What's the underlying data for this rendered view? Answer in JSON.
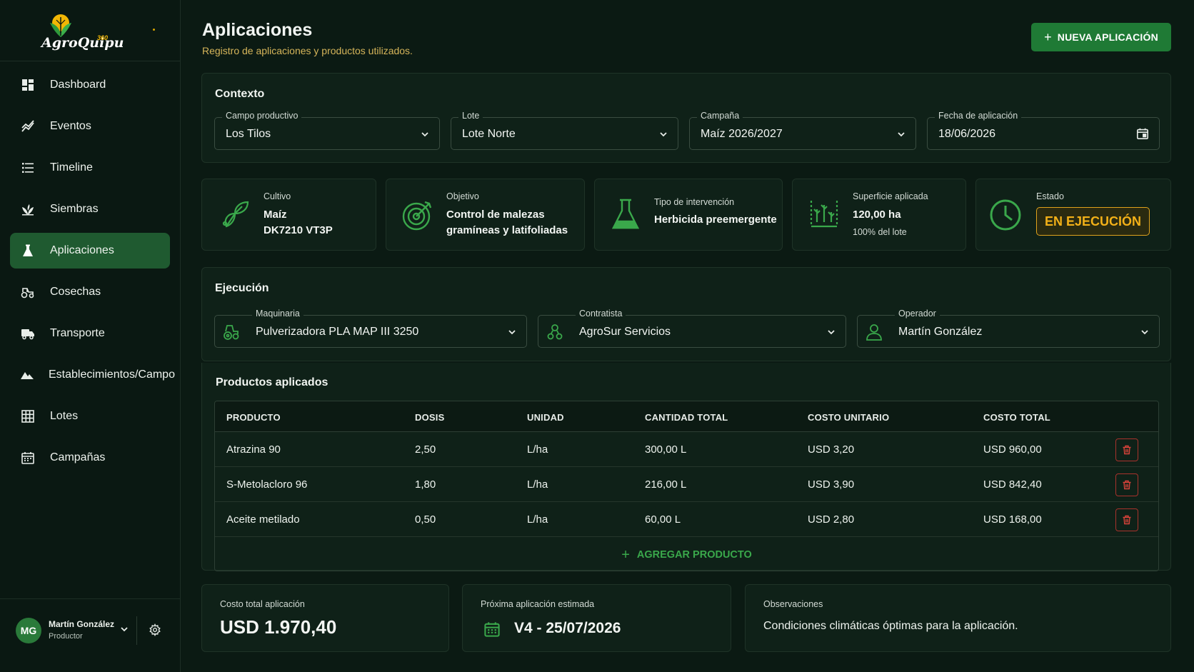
{
  "app": {
    "logo_text": "AgroQuipu",
    "logo_badge": "360"
  },
  "sidebar": {
    "items": [
      {
        "label": "Dashboard",
        "icon": "dashboard-icon"
      },
      {
        "label": "Eventos",
        "icon": "chart-line-icon"
      },
      {
        "label": "Timeline",
        "icon": "list-icon"
      },
      {
        "label": "Siembras",
        "icon": "sprout-icon"
      },
      {
        "label": "Aplicaciones",
        "icon": "flask-icon",
        "active": true
      },
      {
        "label": "Cosechas",
        "icon": "tractor-icon"
      },
      {
        "label": "Transporte",
        "icon": "truck-icon"
      },
      {
        "label": "Establecimientos/Campo",
        "icon": "mountain-icon"
      },
      {
        "label": "Lotes",
        "icon": "grid-icon"
      },
      {
        "label": "Campañas",
        "icon": "calendar-icon"
      }
    ]
  },
  "user": {
    "initials": "MG",
    "name": "Martín González",
    "role": "Productor"
  },
  "header": {
    "title": "Aplicaciones",
    "subtitle": "Registro de aplicaciones y productos utilizados.",
    "new_button": "NUEVA APLICACIÓN"
  },
  "context": {
    "title": "Contexto",
    "campo": {
      "label": "Campo productivo",
      "value": "Los Tilos"
    },
    "lote": {
      "label": "Lote",
      "value": "Lote Norte"
    },
    "campana": {
      "label": "Campaña",
      "value": "Maíz 2026/2027"
    },
    "fecha": {
      "label": "Fecha de aplicación",
      "value": "18/06/2026"
    }
  },
  "stats": {
    "cultivo": {
      "label": "Cultivo",
      "line1": "Maíz",
      "line2": "DK7210 VT3P"
    },
    "objetivo": {
      "label": "Objetivo",
      "line1": "Control de malezas",
      "line2": "gramíneas y latifoliadas"
    },
    "tipo": {
      "label": "Tipo de intervención",
      "value": "Herbicida preemergente"
    },
    "superficie": {
      "label": "Superficie aplicada",
      "value": "120,00 ha",
      "sub": "100% del lote"
    },
    "estado": {
      "label": "Estado",
      "value": "EN EJECUCIÓN"
    }
  },
  "execution": {
    "title": "Ejecución",
    "maquinaria": {
      "label": "Maquinaria",
      "value": "Pulverizadora PLA MAP III 3250"
    },
    "contratista": {
      "label": "Contratista",
      "value": "AgroSur Servicios"
    },
    "operador": {
      "label": "Operador",
      "value": "Martín González"
    }
  },
  "products": {
    "title": "Productos aplicados",
    "columns": [
      "PRODUCTO",
      "DOSIS",
      "UNIDAD",
      "CANTIDAD TOTAL",
      "COSTO UNITARIO",
      "COSTO TOTAL"
    ],
    "rows": [
      {
        "producto": "Atrazina 90",
        "dosis": "2,50",
        "unidad": "L/ha",
        "cantidad": "300,00 L",
        "costo_unitario": "USD 3,20",
        "costo_total": "USD 960,00"
      },
      {
        "producto": "S-Metolacloro 96",
        "dosis": "1,80",
        "unidad": "L/ha",
        "cantidad": "216,00 L",
        "costo_unitario": "USD 3,90",
        "costo_total": "USD 842,40"
      },
      {
        "producto": "Aceite metilado",
        "dosis": "0,50",
        "unidad": "L/ha",
        "cantidad": "60,00 L",
        "costo_unitario": "USD 2,80",
        "costo_total": "USD 168,00"
      }
    ],
    "add_label": "AGREGAR PRODUCTO"
  },
  "summary": {
    "costo": {
      "label": "Costo total aplicación",
      "value": "USD 1.970,40"
    },
    "proxima": {
      "label": "Próxima aplicación estimada",
      "value": "V4 - 25/07/2026"
    },
    "observaciones": {
      "label": "Observaciones",
      "value": "Condiciones climáticas óptimas para la aplicación."
    }
  },
  "colors": {
    "background": "#0b1a13",
    "accent_green": "#1f7a35",
    "active_nav": "#1f5a30",
    "status_amber": "#f2b018",
    "delete_red": "#c0392b"
  }
}
